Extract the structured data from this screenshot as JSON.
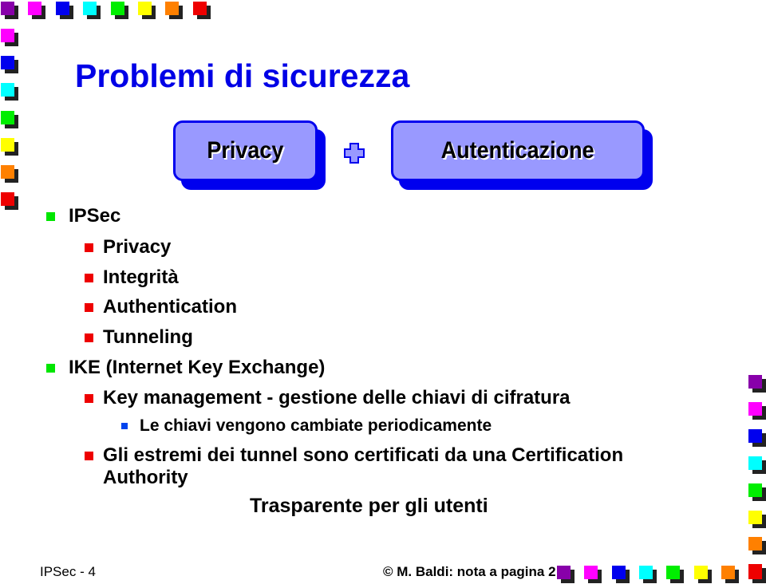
{
  "slide": {
    "title": "Problemi di sicurezza",
    "boxes": [
      {
        "label": "Privacy"
      },
      {
        "label": "Autenticazione"
      }
    ],
    "connector_icon": "plus-icon",
    "bullets": [
      {
        "level": 1,
        "text": "IPSec",
        "bullet_color": "#00e600"
      },
      {
        "level": 2,
        "text": "Privacy",
        "bullet_color": "#ee0000"
      },
      {
        "level": 2,
        "text": "Integrità",
        "bullet_color": "#ee0000"
      },
      {
        "level": 2,
        "text": "Authentication",
        "bullet_color": "#ee0000"
      },
      {
        "level": 2,
        "text": "Tunneling",
        "bullet_color": "#ee0000"
      },
      {
        "level": 1,
        "text": "IKE (Internet Key Exchange)",
        "bullet_color": "#00e600"
      },
      {
        "level": 2,
        "text": "Key management - gestione delle chiavi di cifratura",
        "bullet_color": "#ee0000"
      },
      {
        "level": 3,
        "text": "Le chiavi vengono cambiate periodicamente",
        "bullet_color": "#0044ee"
      },
      {
        "level": 2,
        "text": "Gli estremi dei tunnel sono certificati da una Certification",
        "continuation": "Authority",
        "bullet_color": "#ee0000"
      }
    ],
    "note": "Trasparente per gli utenti"
  },
  "footer": {
    "left": "IPSec - 4",
    "right": "© M. Baldi: nota a pagina 2"
  },
  "decor": {
    "colors": [
      "#8800aa",
      "#ff00ff",
      "#0000ee",
      "#00ffff",
      "#00ee00",
      "#ffff00",
      "#ff8000",
      "#ee0000"
    ],
    "title_color": "#0000e6",
    "box_fill": "#9999ff",
    "box_border": "#0000ee"
  }
}
